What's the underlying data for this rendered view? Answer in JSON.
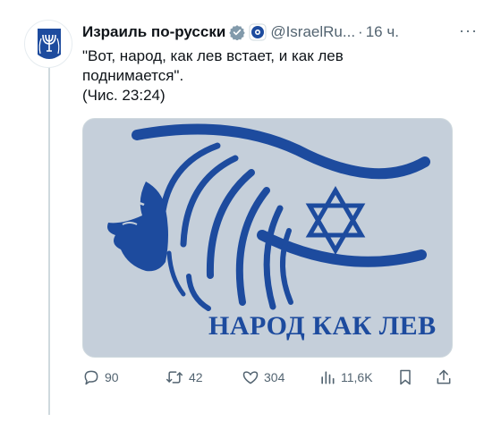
{
  "tweet": {
    "author_name": "Израиль по-русски",
    "handle": "@IsraelRu...",
    "separator": "·",
    "time": "16 ч.",
    "more": "···",
    "lines": [
      "\"Вот, народ, как лев встает, и как лев",
      "поднимается\".",
      "(Чис. 23:24)"
    ]
  },
  "media": {
    "caption": "НАРОД  КАК ЛЕВ",
    "colors": {
      "background": "#c5cfda",
      "blue": "#1d4b9e"
    }
  },
  "actions": {
    "replies": "90",
    "reposts": "42",
    "likes": "304",
    "views": "11,6K"
  },
  "icons": [
    "menorah-emblem-icon",
    "verified-badge-icon",
    "affiliate-badge-icon",
    "more-icon",
    "reply-icon",
    "repost-icon",
    "like-icon",
    "views-icon",
    "bookmark-icon",
    "share-icon"
  ],
  "colors": {
    "text": "#0f1419",
    "muted": "#536471",
    "verified": "#829aab",
    "accent_blue": "#1d4b9e"
  }
}
